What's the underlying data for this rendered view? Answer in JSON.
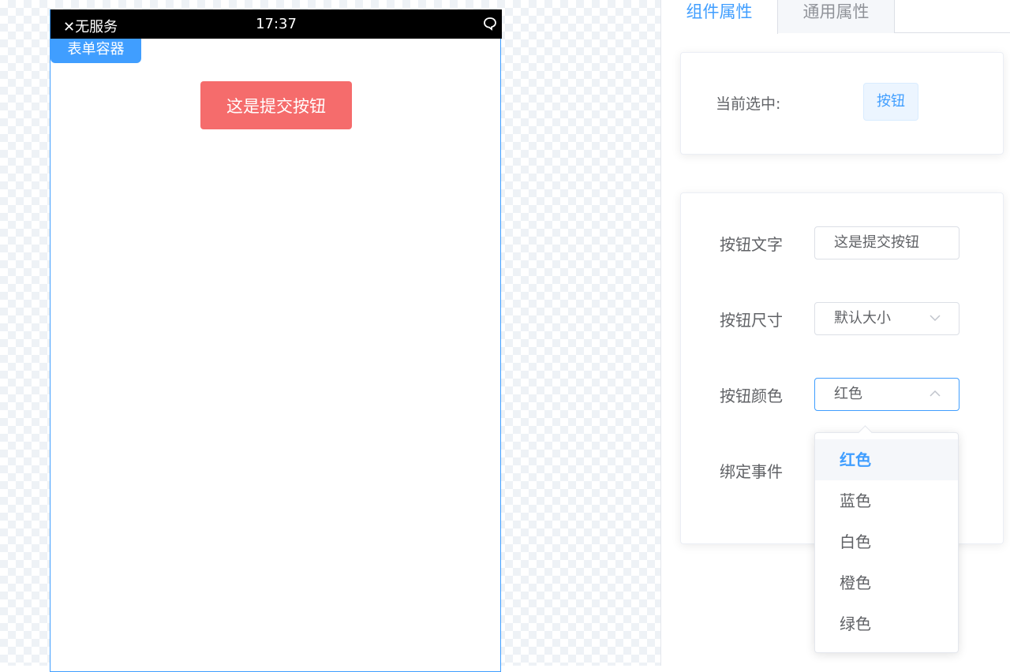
{
  "phone": {
    "status_signal": "✕无服务",
    "status_time": "17:37",
    "form_container_label": "表单容器",
    "submit_button_label": "这是提交按钮",
    "submit_button_color": "#f56c6c"
  },
  "tabs": [
    {
      "label": "组件属性",
      "active": true
    },
    {
      "label": "通用属性",
      "active": false
    }
  ],
  "selected": {
    "label": "当前选中:",
    "value": "按钮"
  },
  "props": {
    "text_label": "按钮文字",
    "text_value": "这是提交按钮",
    "size_label": "按钮尺寸",
    "size_value": "默认大小",
    "color_label": "按钮颜色",
    "color_value": "红色",
    "event_label": "绑定事件"
  },
  "dropdown": {
    "options": [
      "红色",
      "蓝色",
      "白色",
      "橙色",
      "绿色"
    ],
    "selected": "红色"
  },
  "colors": {
    "accent": "#409eff",
    "danger": "#f56c6c"
  },
  "icons": {
    "status_close": "close-icon",
    "status_chat": "chat-bubble-icon",
    "select_arrow_down": "chevron-down-icon",
    "select_arrow_up": "chevron-up-icon"
  }
}
